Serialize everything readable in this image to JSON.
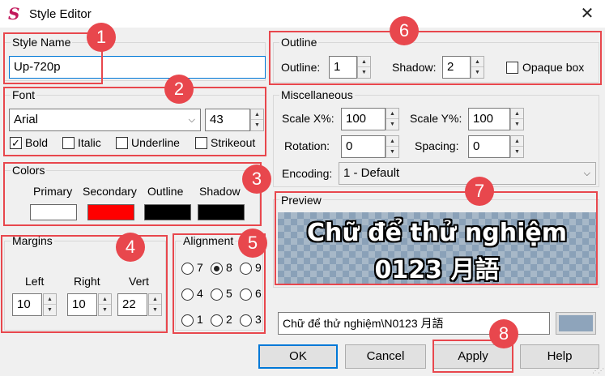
{
  "window": {
    "title": "Style Editor",
    "close_glyph": "✕"
  },
  "style_name": {
    "label": "Style Name",
    "value": "Up-720p"
  },
  "font": {
    "label": "Font",
    "family": "Arial",
    "size": "43",
    "bold_label": "Bold",
    "bold_checked": true,
    "italic_label": "Italic",
    "italic_checked": false,
    "underline_label": "Underline",
    "underline_checked": false,
    "strikeout_label": "Strikeout",
    "strikeout_checked": false
  },
  "colors": {
    "label": "Colors",
    "primary_label": "Primary",
    "primary": "#ffffff",
    "secondary_label": "Secondary",
    "secondary": "#ff0000",
    "outline_label": "Outline",
    "outline": "#000000",
    "shadow_label": "Shadow",
    "shadow": "#000000"
  },
  "margins": {
    "label": "Margins",
    "left_label": "Left",
    "left": "10",
    "right_label": "Right",
    "right": "10",
    "vert_label": "Vert",
    "vert": "22"
  },
  "alignment": {
    "label": "Alignment",
    "options": [
      "7",
      "8",
      "9",
      "4",
      "5",
      "6",
      "1",
      "2",
      "3"
    ],
    "selected": "8"
  },
  "outline": {
    "label": "Outline",
    "outline_label": "Outline:",
    "outline_value": "1",
    "shadow_label": "Shadow:",
    "shadow_value": "2",
    "opaque_label": "Opaque box",
    "opaque_checked": false
  },
  "misc": {
    "label": "Miscellaneous",
    "scale_x_label": "Scale X%:",
    "scale_x": "100",
    "scale_y_label": "Scale Y%:",
    "scale_y": "100",
    "rotation_label": "Rotation:",
    "rotation": "0",
    "spacing_label": "Spacing:",
    "spacing": "0",
    "encoding_label": "Encoding:",
    "encoding": "1 - Default"
  },
  "preview": {
    "label": "Preview",
    "line1": "Chữ để thử nghiệm",
    "line2": "0123 月語",
    "text_input": "Chữ để thử nghiệm\\N0123 月語",
    "bg_color": "#8ea4bb"
  },
  "buttons": {
    "ok": "OK",
    "cancel": "Cancel",
    "apply": "Apply",
    "help": "Help"
  },
  "annotations": [
    "1",
    "2",
    "3",
    "4",
    "5",
    "6",
    "7",
    "8"
  ],
  "annotation_color": "#e8474d"
}
